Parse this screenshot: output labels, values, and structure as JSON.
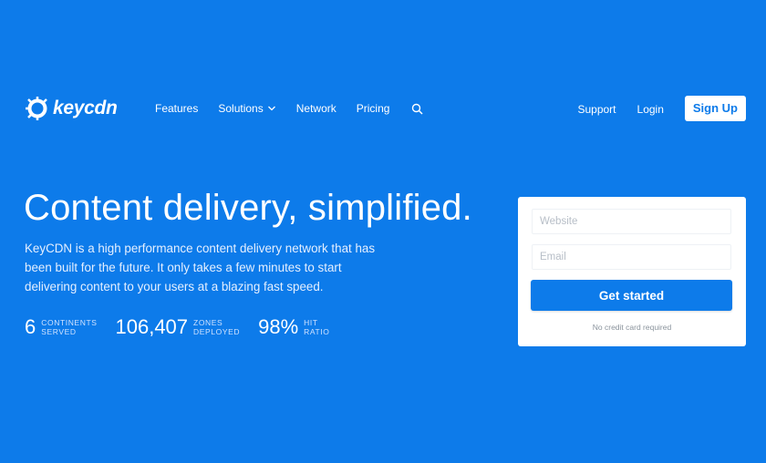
{
  "brand": {
    "name": "keycdn"
  },
  "nav": {
    "links": [
      "Features",
      "Solutions",
      "Network",
      "Pricing"
    ],
    "support": "Support",
    "login": "Login",
    "signup": "Sign Up"
  },
  "hero": {
    "title": "Content delivery, simplified.",
    "description": "KeyCDN is a high performance content delivery network that has been built for the future. It only takes a few minutes to start delivering content to your users at a blazing fast speed.",
    "stats": [
      {
        "value": "6",
        "label_line1": "CONTINENTS",
        "label_line2": "SERVED"
      },
      {
        "value": "106,407",
        "label_line1": "ZONES",
        "label_line2": "DEPLOYED"
      },
      {
        "value": "98%",
        "label_line1": "HIT",
        "label_line2": "RATIO"
      }
    ]
  },
  "signup_form": {
    "website_placeholder": "Website",
    "email_placeholder": "Email",
    "button": "Get started",
    "note": "No credit card required"
  },
  "colors": {
    "brand_blue": "#0d7bea",
    "white": "#ffffff"
  }
}
